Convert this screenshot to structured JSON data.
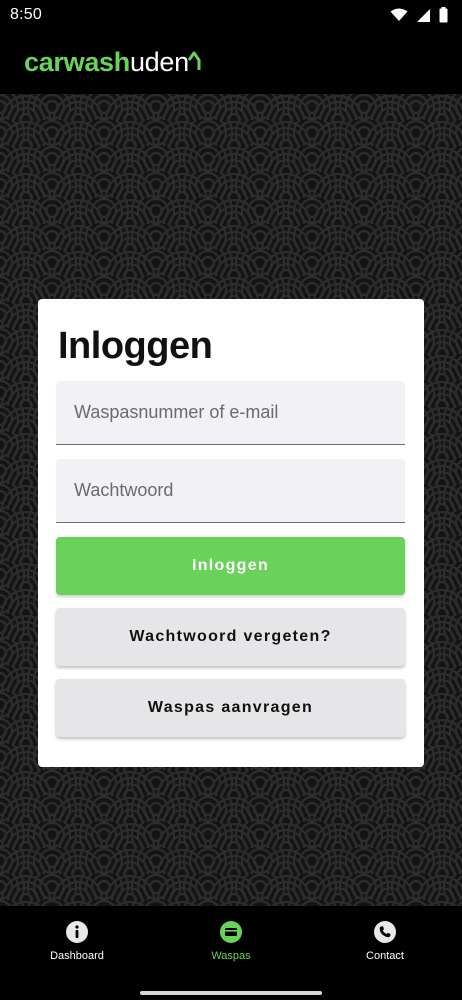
{
  "status_bar": {
    "time": "8:50"
  },
  "header": {
    "logo_part1": "carwash",
    "logo_part2": "uden"
  },
  "login": {
    "title": "Inloggen",
    "email_placeholder": "Waspasnummer of e-mail",
    "password_placeholder": "Wachtwoord",
    "login_button": "Inloggen",
    "forgot_button": "Wachtwoord vergeten?",
    "request_button": "Waspas aanvragen"
  },
  "bottom_nav": {
    "items": [
      {
        "label": "Dashboard",
        "icon": "info-icon"
      },
      {
        "label": "Waspas",
        "icon": "card-icon",
        "active": true
      },
      {
        "label": "Contact",
        "icon": "phone-icon"
      }
    ]
  },
  "colors": {
    "brand_green": "#6ad25a",
    "background": "#000000",
    "field_bg": "#f2f1f5",
    "secondary_button": "#e6e5e8"
  }
}
